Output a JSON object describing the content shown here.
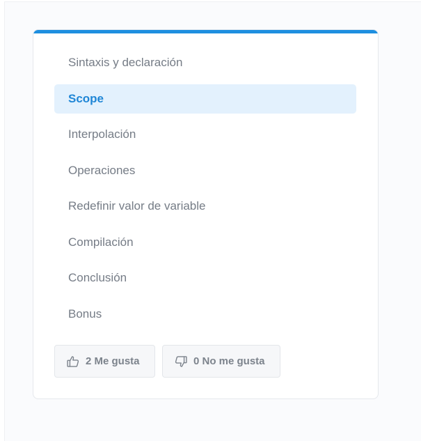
{
  "toc": {
    "items": [
      {
        "label": "Sintaxis y declaración",
        "active": false
      },
      {
        "label": "Scope",
        "active": true
      },
      {
        "label": "Interpolación",
        "active": false
      },
      {
        "label": "Operaciones",
        "active": false
      },
      {
        "label": "Redefinir valor de variable",
        "active": false
      },
      {
        "label": "Compilación",
        "active": false
      },
      {
        "label": "Conclusión",
        "active": false
      },
      {
        "label": "Bonus",
        "active": false
      }
    ]
  },
  "reactions": {
    "likes_label": "2 Me gusta",
    "dislikes_label": "0 No me gusta",
    "like_icon": "thumbs-up-icon",
    "dislike_icon": "thumbs-down-icon"
  },
  "colors": {
    "accent": "#1e8fe0",
    "active_bg": "#e3f1fd",
    "active_text": "#1f86d6",
    "item_text": "#757c86"
  }
}
